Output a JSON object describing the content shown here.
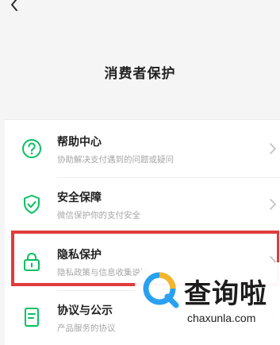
{
  "header": {
    "title": "消费者保护"
  },
  "items": [
    {
      "title": "帮助中心",
      "subtitle": "协助解决支付遇到的问题或疑问",
      "icon": "help-circle-icon"
    },
    {
      "title": "安全保障",
      "subtitle": "微信保护你的支付安全",
      "icon": "shield-check-icon"
    },
    {
      "title": "隐私保护",
      "subtitle": "隐私政策与信息收集说明",
      "icon": "lock-icon"
    },
    {
      "title": "协议与公示",
      "subtitle": "产品服务的协议",
      "icon": "document-icon"
    }
  ],
  "watermark": {
    "name": "查询啦",
    "url": "chaxunla.com"
  },
  "colors": {
    "accent": "#07c160",
    "highlight": "#e23b3b"
  }
}
